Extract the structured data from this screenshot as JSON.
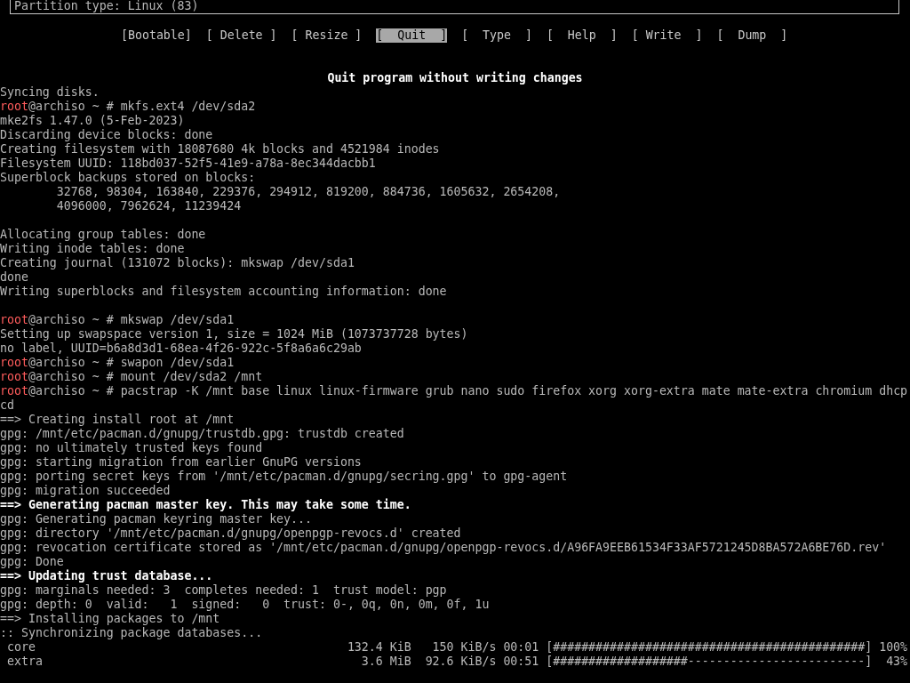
{
  "partition_box": {
    "text": "Partition type: Linux (83)"
  },
  "menu": [
    {
      "label": "[Bootable]",
      "selected": false
    },
    {
      "label": "[ Delete ]",
      "selected": false
    },
    {
      "label": "[ Resize ]",
      "selected": false
    },
    {
      "label": "[  Quit  ]",
      "selected": true
    },
    {
      "label": "[  Type  ]",
      "selected": false
    },
    {
      "label": "[  Help  ]",
      "selected": false
    },
    {
      "label": "[ Write  ]",
      "selected": false
    },
    {
      "label": "[  Dump  ]",
      "selected": false
    }
  ],
  "hint": "Quit program without writing changes",
  "lines": [
    {
      "kind": "text",
      "text": "Syncing disks."
    },
    {
      "kind": "prompt",
      "user": "root",
      "rest": "@archiso ~ # mkfs.ext4 /dev/sda2"
    },
    {
      "kind": "text",
      "text": "mke2fs 1.47.0 (5-Feb-2023)"
    },
    {
      "kind": "text",
      "text": "Discarding device blocks: done"
    },
    {
      "kind": "text",
      "text": "Creating filesystem with 18087680 4k blocks and 4521984 inodes"
    },
    {
      "kind": "text",
      "text": "Filesystem UUID: 118bd037-52f5-41e9-a78a-8ec344dacbb1"
    },
    {
      "kind": "text",
      "text": "Superblock backups stored on blocks:"
    },
    {
      "kind": "text",
      "text": "        32768, 98304, 163840, 229376, 294912, 819200, 884736, 1605632, 2654208,"
    },
    {
      "kind": "text",
      "text": "        4096000, 7962624, 11239424"
    },
    {
      "kind": "blank"
    },
    {
      "kind": "text",
      "text": "Allocating group tables: done"
    },
    {
      "kind": "text",
      "text": "Writing inode tables: done"
    },
    {
      "kind": "text",
      "text": "Creating journal (131072 blocks): mkswap /dev/sda1"
    },
    {
      "kind": "text",
      "text": "done"
    },
    {
      "kind": "text",
      "text": "Writing superblocks and filesystem accounting information: done"
    },
    {
      "kind": "blank"
    },
    {
      "kind": "prompt",
      "user": "root",
      "rest": "@archiso ~ # mkswap /dev/sda1"
    },
    {
      "kind": "text",
      "text": "Setting up swapspace version 1, size = 1024 MiB (1073737728 bytes)"
    },
    {
      "kind": "text",
      "text": "no label, UUID=b6a8d3d1-68ea-4f26-922c-5f8a6a6c29ab"
    },
    {
      "kind": "prompt",
      "user": "root",
      "rest": "@archiso ~ # swapon /dev/sda1"
    },
    {
      "kind": "prompt",
      "user": "root",
      "rest": "@archiso ~ # mount /dev/sda2 /mnt"
    },
    {
      "kind": "prompt",
      "user": "root",
      "rest": "@archiso ~ # pacstrap -K /mnt base linux linux-firmware grub nano sudo firefox xorg xorg-extra mate mate-extra chromium dhcp"
    },
    {
      "kind": "text",
      "text": "cd"
    },
    {
      "kind": "text",
      "text": "==> Creating install root at /mnt"
    },
    {
      "kind": "text",
      "text": "gpg: /mnt/etc/pacman.d/gnupg/trustdb.gpg: trustdb created"
    },
    {
      "kind": "text",
      "text": "gpg: no ultimately trusted keys found"
    },
    {
      "kind": "text",
      "text": "gpg: starting migration from earlier GnuPG versions"
    },
    {
      "kind": "text",
      "text": "gpg: porting secret keys from '/mnt/etc/pacman.d/gnupg/secring.gpg' to gpg-agent"
    },
    {
      "kind": "text",
      "text": "gpg: migration succeeded"
    },
    {
      "kind": "strong",
      "text": "==> Generating pacman master key. This may take some time."
    },
    {
      "kind": "text",
      "text": "gpg: Generating pacman keyring master key..."
    },
    {
      "kind": "text",
      "text": "gpg: directory '/mnt/etc/pacman.d/gnupg/openpgp-revocs.d' created"
    },
    {
      "kind": "text",
      "text": "gpg: revocation certificate stored as '/mnt/etc/pacman.d/gnupg/openpgp-revocs.d/A96FA9EEB61534F33AF5721245D8BA572A6BE76D.rev'"
    },
    {
      "kind": "text",
      "text": "gpg: Done"
    },
    {
      "kind": "strong",
      "text": "==> Updating trust database..."
    },
    {
      "kind": "text",
      "text": "gpg: marginals needed: 3  completes needed: 1  trust model: pgp"
    },
    {
      "kind": "text",
      "text": "gpg: depth: 0  valid:   1  signed:   0  trust: 0-, 0q, 0n, 0m, 0f, 1u"
    },
    {
      "kind": "text",
      "text": "==> Installing packages to /mnt"
    },
    {
      "kind": "text",
      "text": ":: Synchronizing package databases..."
    },
    {
      "kind": "text",
      "text": " core                                            132.4 KiB   150 KiB/s 00:01 [############################################] 100%"
    },
    {
      "kind": "text",
      "text": " extra                                             3.6 MiB  92.6 KiB/s 00:51 [###################-------------------------]  43%"
    }
  ]
}
